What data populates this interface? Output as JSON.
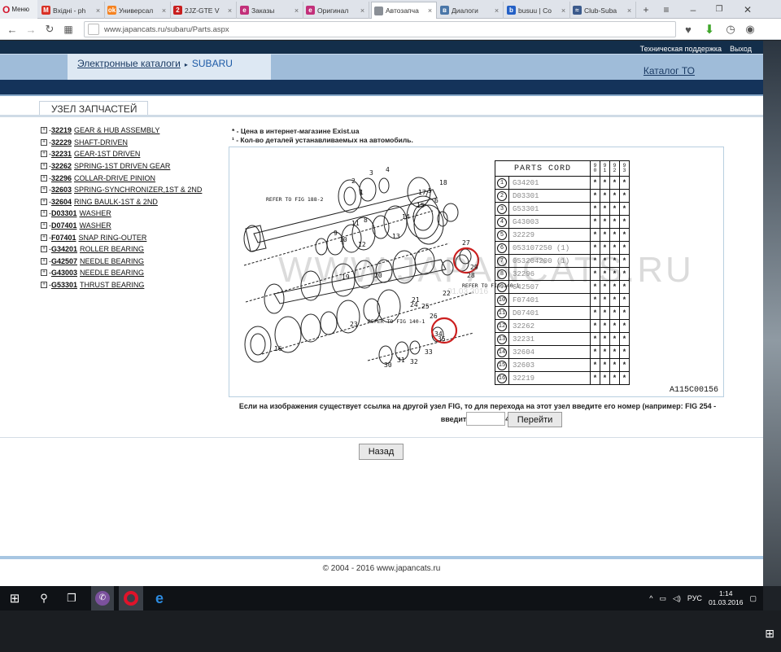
{
  "browser": {
    "menu_label": "Меню",
    "tabs": [
      {
        "label": "Вхідні - ph",
        "icon": "gmail-icon",
        "color": "#d93025",
        "glyph": "M"
      },
      {
        "label": "Универсал",
        "icon": "odnoklassniki-icon",
        "color": "#f58220",
        "glyph": "ok"
      },
      {
        "label": "2JZ-GTE V",
        "icon": "drive2-icon",
        "color": "#c81e1e",
        "glyph": "2"
      },
      {
        "label": "Заказы",
        "icon": "exist-icon",
        "color": "#c22f7a",
        "glyph": "e"
      },
      {
        "label": "Оригинал",
        "icon": "exist-icon",
        "color": "#c22f7a",
        "glyph": "e"
      },
      {
        "label": "Автозапча",
        "icon": "page-icon",
        "color": "#8a8f96",
        "glyph": ""
      },
      {
        "label": "Диалоги",
        "icon": "vk-icon",
        "color": "#4a76a8",
        "glyph": "в"
      },
      {
        "label": "busuu | Co",
        "icon": "busuu-icon",
        "color": "#2460c6",
        "glyph": "b"
      },
      {
        "label": "Club-Suba",
        "icon": "car-icon",
        "color": "#3b5a8c",
        "glyph": "≈"
      }
    ],
    "new_tab": "+",
    "url": "www.japancats.ru/subaru/Parts.aspx"
  },
  "site": {
    "support_label": "Техническая поддержка",
    "logout_label": "Выход",
    "breadcrumb": {
      "catalogs": "Электронные каталоги",
      "arrow": "▸",
      "brand": "SUBARU"
    },
    "to_catalog": "Каталог ТО",
    "node_tab": "УЗЕЛ ЗАПЧАСТЕЙ"
  },
  "parts_list": [
    {
      "code": "32219",
      "name": "GEAR & HUB ASSEMBLY"
    },
    {
      "code": "32229",
      "name": "SHAFT-DRIVEN"
    },
    {
      "code": "32231",
      "name": "GEAR-1ST DRIVEN"
    },
    {
      "code": "32262",
      "name": "SPRING-1ST DRIVEN GEAR"
    },
    {
      "code": "32296",
      "name": "COLLAR-DRIVE PINION"
    },
    {
      "code": "32603",
      "name": "SPRING-SYNCHRONIZER,1ST & 2ND"
    },
    {
      "code": "32604",
      "name": "RING BAULK-1ST & 2ND"
    },
    {
      "code": "D03301",
      "name": "WASHER"
    },
    {
      "code": "D07401",
      "name": "WASHER"
    },
    {
      "code": "F07401",
      "name": "SNAP RING-OUTER"
    },
    {
      "code": "G34201",
      "name": "ROLLER BEARING"
    },
    {
      "code": "G42507",
      "name": "NEEDLE BEARING"
    },
    {
      "code": "G43003",
      "name": "NEEDLE BEARING"
    },
    {
      "code": "G53301",
      "name": "THRUST BEARING"
    }
  ],
  "notes": {
    "price_note": "* - Цена в интернет-магазине Exist.ua",
    "qty_note": "¹ - Кол-во деталей устанавливаемых на автомобиль."
  },
  "figure": {
    "table_title": "PARTS CORD",
    "columns": [
      "9 0",
      "9 1",
      "9 2",
      "9 3"
    ],
    "rows": [
      {
        "n": "1",
        "code": "G34201"
      },
      {
        "n": "2",
        "code": "D03301"
      },
      {
        "n": "3",
        "code": "G53301"
      },
      {
        "n": "4",
        "code": "G43003"
      },
      {
        "n": "5",
        "code": "32229"
      },
      {
        "n": "6",
        "code": "053107250 (1)"
      },
      {
        "n": "7",
        "code": "053204200 (1)"
      },
      {
        "n": "8",
        "code": "32296"
      },
      {
        "n": "9",
        "code": "G42507"
      },
      {
        "n": "10",
        "code": "F07401"
      },
      {
        "n": "11",
        "code": "D07401"
      },
      {
        "n": "12",
        "code": "32262"
      },
      {
        "n": "13",
        "code": "32231"
      },
      {
        "n": "14",
        "code": "32604"
      },
      {
        "n": "15",
        "code": "32603"
      },
      {
        "n": "16",
        "code": "32219"
      }
    ],
    "refer_1": "REFER TO FIG 188-2",
    "refer_2": "REFER TO FIG 140-1",
    "refer_3": "REFER TO FIG 140-1",
    "figure_code": "A115C00156",
    "watermark": "WWW.JAPANCATS.RU",
    "watermark_date": "01.03.2016",
    "numbers": [
      "3",
      "4",
      "1",
      "2",
      "5",
      "6",
      "7",
      "8",
      "9",
      "10",
      "11",
      "12",
      "13",
      "14",
      "15",
      "16",
      "17",
      "18",
      "19",
      "20",
      "21",
      "22",
      "23",
      "24",
      "25",
      "26",
      "27",
      "28",
      "29",
      "30",
      "31",
      "32",
      "33",
      "34",
      "35"
    ]
  },
  "fig_jump": {
    "text": "Если на изображения существует ссылка на другой узел FIG, то для перехода на этот узел введите его номер (например: FIG 254 - введите номер 254):",
    "input_value": "",
    "go_label": "Перейти"
  },
  "back_label": "Назад",
  "copyright": "© 2004 - 2016 www.japancats.ru",
  "taskbar": {
    "lang": "РУС",
    "time": "1:14",
    "date": "01.03.2016"
  }
}
